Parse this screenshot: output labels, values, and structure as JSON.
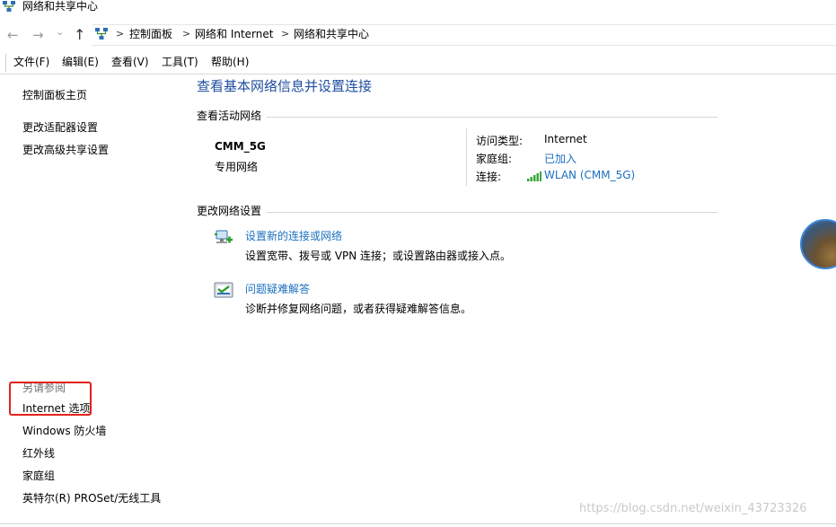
{
  "window": {
    "title": "网络和共享中心"
  },
  "address_bar": {
    "crumbs": [
      "控制面板",
      "网络和 Internet",
      "网络和共享中心"
    ],
    "separator": ">",
    "nav_back": "←",
    "nav_forward": "→",
    "nav_dropdown": "⌄",
    "nav_up": "↑"
  },
  "menu": {
    "file": "文件(F)",
    "edit": "编辑(E)",
    "view": "查看(V)",
    "tools": "工具(T)",
    "help": "帮助(H)"
  },
  "sidebar": {
    "home": "控制面板主页",
    "adapter": "更改适配器设置",
    "advanced_sharing": "更改高级共享设置",
    "see_also": "另请参阅",
    "internet_options": "Internet 选项",
    "firewall": "Windows 防火墙",
    "infrared": "红外线",
    "homegroup": "家庭组",
    "intel": "英特尔(R) PROSet/无线工具"
  },
  "main": {
    "title": "查看基本网络信息并设置连接",
    "active_networks_head": "查看活动网络",
    "network_name": "CMM_5G",
    "network_category": "专用网络",
    "access_type_label": "访问类型:",
    "access_type_value": "Internet",
    "homegroup_label": "家庭组:",
    "homegroup_value": "已加入",
    "connection_label": "连接:",
    "connection_value": "WLAN (CMM_5G)",
    "change_settings_head": "更改网络设置",
    "task1_title": "设置新的连接或网络",
    "task1_desc": "设置宽带、拨号或 VPN 连接；或设置路由器或接入点。",
    "task2_title": "问题疑难解答",
    "task2_desc": "诊断并修复网络问题，或者获得疑难解答信息。"
  },
  "watermark": "https://blog.csdn.net/weixin_43723326",
  "colors": {
    "link": "#1c6fbf",
    "title": "#1e4e9f",
    "highlight": "#e2231a"
  }
}
